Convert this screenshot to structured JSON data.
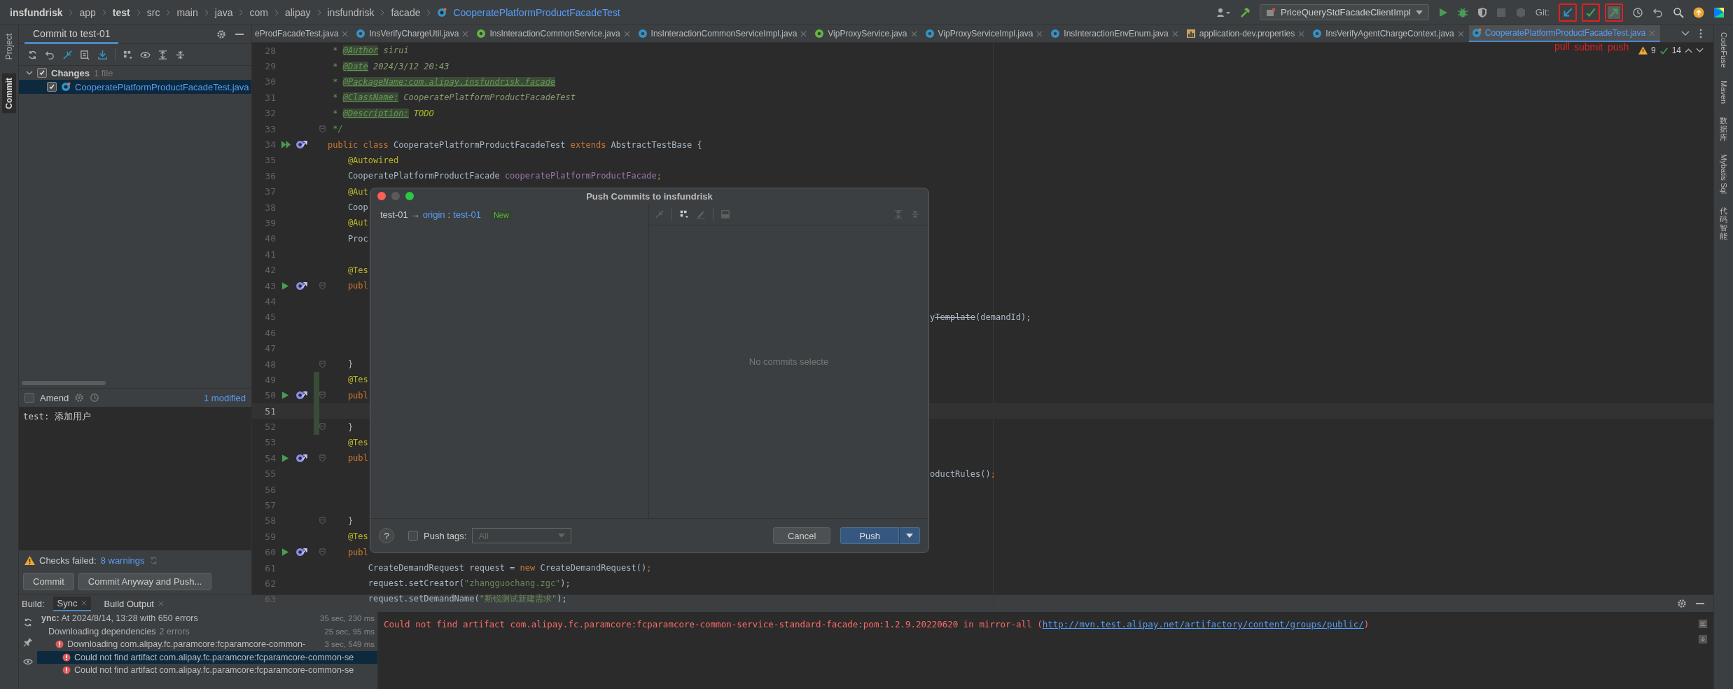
{
  "breadcrumb": [
    {
      "label": "insfundrisk",
      "bold": true,
      "kind": "dir"
    },
    {
      "label": "app",
      "bold": false,
      "kind": "dir"
    },
    {
      "label": "test",
      "bold": true,
      "kind": "dir"
    },
    {
      "label": "src",
      "bold": false,
      "kind": "dir"
    },
    {
      "label": "main",
      "bold": false,
      "kind": "dir"
    },
    {
      "label": "java",
      "bold": false,
      "kind": "dir"
    },
    {
      "label": "com",
      "bold": false,
      "kind": "dir"
    },
    {
      "label": "alipay",
      "bold": false,
      "kind": "dir"
    },
    {
      "label": "insfundrisk",
      "bold": false,
      "kind": "dir"
    },
    {
      "label": "facade",
      "bold": false,
      "kind": "dir"
    },
    {
      "label": "CooperatePlatformProductFacadeTest",
      "bold": false,
      "kind": "file"
    }
  ],
  "toolbar": {
    "run_config": "PriceQueryStdFacadeClientImpl",
    "vcs_label": "Git:",
    "annotations": [
      "pull",
      "submit",
      "push"
    ]
  },
  "left_stripe": [
    {
      "label": "Project",
      "selected": false
    },
    {
      "label": "Commit",
      "selected": true
    }
  ],
  "right_stripe": [
    {
      "label": "CodeFuse",
      "kind": "rotated"
    },
    {
      "label": "Maven",
      "kind": "rotated"
    },
    {
      "label": "数据库",
      "kind": "stacked"
    },
    {
      "label": "Mybatis Sql",
      "kind": "rotated"
    },
    {
      "label": "代码智能",
      "kind": "stacked"
    }
  ],
  "commit": {
    "title": "Commit to test-01",
    "changes": {
      "label": "Changes",
      "count": "1 file",
      "checked": true,
      "expanded": true,
      "files": [
        {
          "name": "CooperatePlatformProductFacadeTest.java",
          "checked": true,
          "selected": true
        }
      ]
    },
    "amend": {
      "label": "Amend",
      "checked": false
    },
    "modified": "1 modified",
    "message": "test: 添加用户",
    "checks": {
      "label": "Checks failed:",
      "link": "8 warnings"
    },
    "buttons": [
      "Commit",
      "Commit Anyway and Push..."
    ]
  },
  "tabs": [
    {
      "label": "eProdFacadeTest.java",
      "kind": "test",
      "selected": false
    },
    {
      "label": "InsVerifyChargeUtil.java",
      "kind": "class",
      "selected": false
    },
    {
      "label": "InsInteractionCommonService.java",
      "kind": "interface",
      "selected": false
    },
    {
      "label": "InsInteractionCommonServiceImpl.java",
      "kind": "class",
      "selected": false
    },
    {
      "label": "VipProxyService.java",
      "kind": "interface",
      "selected": false
    },
    {
      "label": "VipProxyServiceImpl.java",
      "kind": "class",
      "selected": false
    },
    {
      "label": "InsInteractionEnvEnum.java",
      "kind": "enum",
      "selected": false
    },
    {
      "label": "application-dev.properties",
      "kind": "properties",
      "selected": false
    },
    {
      "label": "InsVerifyAgentChargeContext.java",
      "kind": "class",
      "selected": false
    },
    {
      "label": "CooperatePlatformProductFacadeTest.java",
      "kind": "test",
      "selected": true
    }
  ],
  "inspections": {
    "warnings": "9",
    "passed": "14"
  },
  "editor": {
    "lines": [
      {
        "number": "28",
        "current": false,
        "segments": [
          {
            "t": " * ",
            "kind": "doc"
          },
          {
            "t": "@Author",
            "kind": "doctag"
          },
          {
            "t": " sirui",
            "kind": "docval"
          }
        ]
      },
      {
        "number": "29",
        "current": false,
        "segments": [
          {
            "t": " * ",
            "kind": "doc"
          },
          {
            "t": "@Date",
            "kind": "doctag"
          },
          {
            "t": " 2024/3/12 20:43",
            "kind": "docval"
          }
        ]
      },
      {
        "number": "30",
        "current": false,
        "segments": [
          {
            "t": " * ",
            "kind": "doc"
          },
          {
            "t": "@PackageName:com.alipay.insfundrisk.facade",
            "kind": "doctag"
          }
        ]
      },
      {
        "number": "31",
        "current": false,
        "segments": [
          {
            "t": " * ",
            "kind": "doc"
          },
          {
            "t": "@ClassName:",
            "kind": "doctag"
          },
          {
            "t": " CooperatePlatformProductFacadeTest",
            "kind": "docval"
          }
        ]
      },
      {
        "number": "32",
        "current": false,
        "segments": [
          {
            "t": " * ",
            "kind": "doc"
          },
          {
            "t": "@Description:",
            "kind": "doctag"
          },
          {
            "t": " TODO",
            "kind": "todo"
          }
        ]
      },
      {
        "number": "33",
        "current": false,
        "fold": true,
        "segments": [
          {
            "t": " */",
            "kind": "doc"
          }
        ]
      },
      {
        "number": "34",
        "current": false,
        "run": true,
        "suite": true,
        "segments": [
          {
            "t": "public class ",
            "kind": "kw"
          },
          {
            "t": "CooperatePlatformProductFacadeTest",
            "kind": "plain"
          },
          {
            "t": " extends ",
            "kind": "kw"
          },
          {
            "t": "AbstractTestBase {",
            "kind": "plain"
          }
        ]
      },
      {
        "number": "35",
        "current": false,
        "segments": [
          {
            "t": "    @Autowired",
            "kind": "ann"
          }
        ]
      },
      {
        "number": "36",
        "current": false,
        "segments": [
          {
            "t": "    CooperatePlatformProductFacade ",
            "kind": "plain"
          },
          {
            "t": "cooperatePlatformProductFacade",
            "kind": "field"
          },
          {
            "t": ";",
            "kind": "kw"
          }
        ]
      },
      {
        "number": "37",
        "current": false,
        "segments": [
          {
            "t": "    @Aut",
            "kind": "ann"
          }
        ]
      },
      {
        "number": "38",
        "current": false,
        "segments": [
          {
            "t": "    Coop",
            "kind": "plain"
          }
        ]
      },
      {
        "number": "39",
        "current": false,
        "segments": [
          {
            "t": "    @Aut",
            "kind": "ann"
          }
        ]
      },
      {
        "number": "40",
        "current": false,
        "segments": [
          {
            "t": "    Proc",
            "kind": "plain"
          }
        ]
      },
      {
        "number": "41",
        "current": false
      },
      {
        "number": "42",
        "current": false,
        "segments": [
          {
            "t": "    @Tes",
            "kind": "ann"
          }
        ]
      },
      {
        "number": "43",
        "current": false,
        "run": true,
        "suite": false,
        "fold": true,
        "segments": [
          {
            "t": "    publ",
            "kind": "kw"
          }
        ]
      },
      {
        "number": "44",
        "current": false
      },
      {
        "number": "45",
        "current": false,
        "tail": [
          {
            "t": "y",
            "kind": "plain"
          },
          {
            "t": "Template",
            "kind": "deprecated"
          },
          {
            "t": "(demandId);",
            "kind": "plain"
          }
        ]
      },
      {
        "number": "46",
        "current": false
      },
      {
        "number": "47",
        "current": false
      },
      {
        "number": "48",
        "current": false,
        "fold": true,
        "segments": [
          {
            "t": "    }",
            "kind": "plain"
          }
        ]
      },
      {
        "number": "49",
        "changed": true,
        "current": false,
        "segments": [
          {
            "t": "    @Tes",
            "kind": "ann"
          }
        ]
      },
      {
        "number": "50",
        "changed": true,
        "current": false,
        "run": true,
        "suite": false,
        "fold": true,
        "segments": [
          {
            "t": "    publ",
            "kind": "kw"
          }
        ]
      },
      {
        "number": "51",
        "changed": true,
        "current": true
      },
      {
        "number": "52",
        "changed": true,
        "current": false,
        "fold": true,
        "segments": [
          {
            "t": "    }",
            "kind": "plain"
          }
        ]
      },
      {
        "number": "53",
        "current": false,
        "segments": [
          {
            "t": "    @Tes",
            "kind": "ann"
          }
        ]
      },
      {
        "number": "54",
        "current": false,
        "run": true,
        "suite": false,
        "fold": true,
        "segments": [
          {
            "t": "    publ",
            "kind": "kw"
          }
        ]
      },
      {
        "number": "55",
        "current": false,
        "tail": [
          {
            "t": "oductRules()",
            "kind": "plain"
          },
          {
            "t": ";",
            "kind": "kw"
          }
        ]
      },
      {
        "number": "56",
        "current": false
      },
      {
        "number": "57",
        "current": false
      },
      {
        "number": "58",
        "current": false,
        "fold": true,
        "segments": [
          {
            "t": "    }",
            "kind": "plain"
          }
        ]
      },
      {
        "number": "59",
        "current": false,
        "segments": [
          {
            "t": "    @Tes",
            "kind": "ann"
          }
        ]
      },
      {
        "number": "60",
        "current": false,
        "run": true,
        "suite": false,
        "fold": true,
        "segments": [
          {
            "t": "    publ",
            "kind": "kw"
          }
        ]
      },
      {
        "number": "61",
        "current": false,
        "segments": [
          {
            "t": "        CreateDemandRequest request = ",
            "kind": "plain"
          },
          {
            "t": "new",
            "kind": "kw"
          },
          {
            "t": " CreateDemandRequest()",
            "kind": "plain"
          },
          {
            "t": ";",
            "kind": "kw"
          }
        ]
      },
      {
        "number": "62",
        "current": false,
        "segments": [
          {
            "t": "        request.setCreator(",
            "kind": "plain"
          },
          {
            "t": "\"zhangguochang.zgc\"",
            "kind": "str"
          },
          {
            "t": ");",
            "kind": "plain"
          }
        ]
      },
      {
        "number": "63",
        "current": false,
        "segments": [
          {
            "t": "        request.setDemandName(",
            "kind": "plain"
          },
          {
            "t": "\"斯锐测试新建需求\"",
            "kind": "str"
          },
          {
            "t": ");",
            "kind": "plain"
          }
        ]
      }
    ]
  },
  "dialog": {
    "title": "Push Commits to insfundrisk",
    "source": "test-01",
    "arrow": "→",
    "remote": "origin",
    "separator": ":",
    "target": "test-01",
    "badge": "New",
    "empty_text": "No commits selecte",
    "help": "?",
    "push_tags": {
      "label": "Push tags:",
      "checked": false,
      "value": "All"
    },
    "buttons": [
      "Cancel",
      "Push"
    ]
  },
  "build": {
    "label": "Build:",
    "tabs": [
      {
        "label": "Sync",
        "selected": true
      },
      {
        "label": "Build Output",
        "selected": false
      }
    ],
    "tree": [
      {
        "error": false,
        "text": "**ync:** At 2024/8/14, 13:28 with 650 errors",
        "time": "35 sec, 230 ms",
        "selected": false,
        "children": [
          {
            "error": false,
            "text": "Downloading dependencies",
            "note": "2 errors",
            "time": "25 sec, 95 ms",
            "selected": false,
            "children": [
              {
                "error": true,
                "text": "Downloading com.alipay.fc.paramcore:fcparamcore-common-",
                "time": "3 sec, 549 ms",
                "selected": false,
                "children": [
                  {
                    "error": true,
                    "text": "Could not find artifact com.alipay.fc.paramcore:fcparamcore-common-se",
                    "selected": true
                  },
                  {
                    "error": true,
                    "text": "Could not find artifact com.alipay.fc.paramcore:fcparamcore-common-se",
                    "selected": false
                  }
                ]
              }
            ]
          }
        ]
      }
    ],
    "output": {
      "message": "Could not find artifact com.alipay.fc.paramcore:fcparamcore-common-service-standard-facade:pom:1.2.9.20220620 in mirror-all (",
      "link": "http://mvn.test.alipay.net/artifactory/content/groups/public/",
      "suffix": ")"
    }
  }
}
